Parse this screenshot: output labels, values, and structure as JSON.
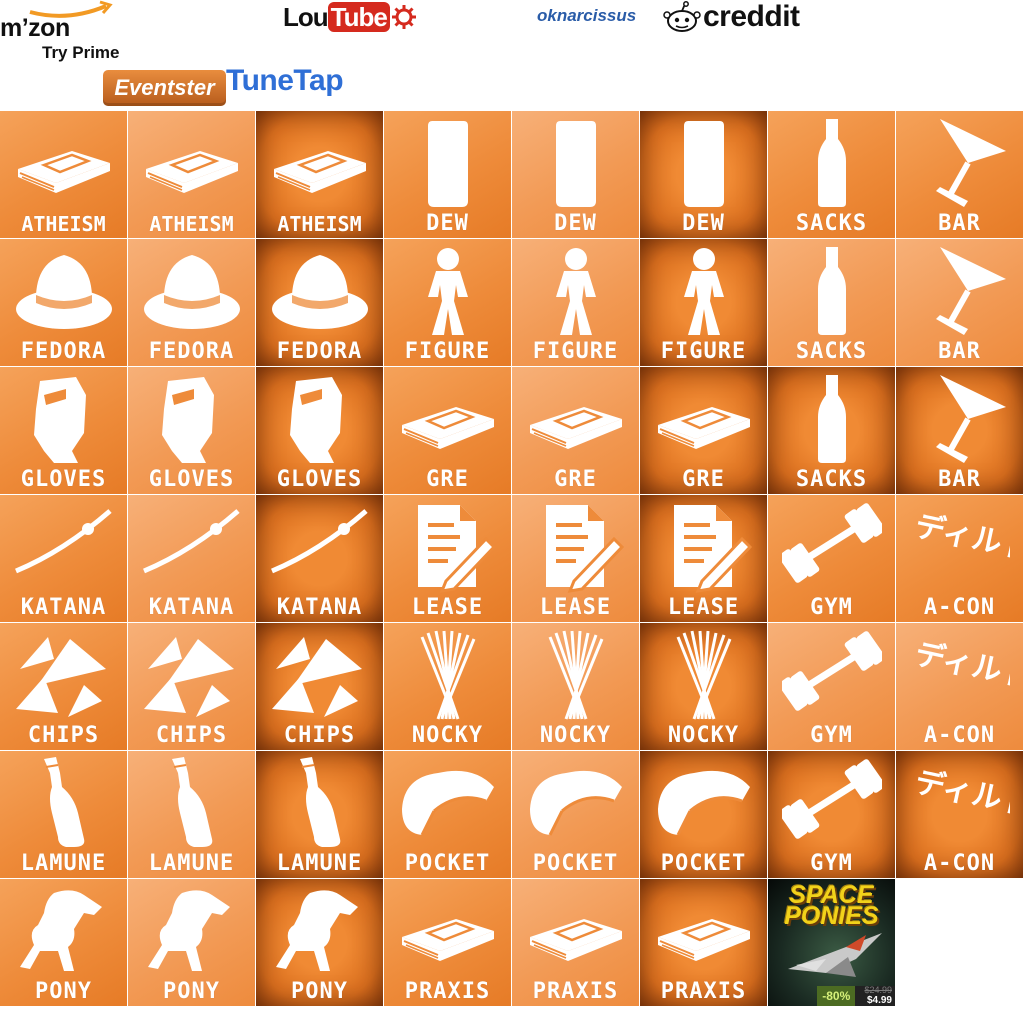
{
  "header": {
    "mzon": {
      "name": "m’zon",
      "sub": "Try Prime"
    },
    "loutube": {
      "left": "Lou",
      "right": "Tube"
    },
    "oknarcissus": "oknarcissus",
    "creddit": "creddit",
    "eventster": "Eventster",
    "tunetap": "TuneTap"
  },
  "tiles": [
    {
      "label": "ATHEISM",
      "icon": "book-icon",
      "shade": "normal"
    },
    {
      "label": "ATHEISM",
      "icon": "book-icon",
      "shade": "light"
    },
    {
      "label": "ATHEISM",
      "icon": "book-icon",
      "shade": "dark"
    },
    {
      "label": "DEW",
      "icon": "can-icon",
      "shade": "normal"
    },
    {
      "label": "DEW",
      "icon": "can-icon",
      "shade": "light"
    },
    {
      "label": "DEW",
      "icon": "can-icon",
      "shade": "dark"
    },
    {
      "label": "SACKS",
      "icon": "bottle-icon",
      "shade": "normal"
    },
    {
      "label": "BAR",
      "icon": "cocktail-icon",
      "shade": "normal"
    },
    {
      "label": "FEDORA",
      "icon": "fedora-icon",
      "shade": "normal"
    },
    {
      "label": "FEDORA",
      "icon": "fedora-icon",
      "shade": "light"
    },
    {
      "label": "FEDORA",
      "icon": "fedora-icon",
      "shade": "dark"
    },
    {
      "label": "FIGURE",
      "icon": "figure-icon",
      "shade": "normal"
    },
    {
      "label": "FIGURE",
      "icon": "figure-icon",
      "shade": "light"
    },
    {
      "label": "FIGURE",
      "icon": "figure-icon",
      "shade": "dark"
    },
    {
      "label": "SACKS",
      "icon": "bottle-icon",
      "shade": "light"
    },
    {
      "label": "BAR",
      "icon": "cocktail-icon",
      "shade": "light"
    },
    {
      "label": "GLOVES",
      "icon": "gloves-icon",
      "shade": "normal"
    },
    {
      "label": "GLOVES",
      "icon": "gloves-icon",
      "shade": "light"
    },
    {
      "label": "GLOVES",
      "icon": "gloves-icon",
      "shade": "dark"
    },
    {
      "label": "GRE",
      "icon": "book-icon",
      "shade": "normal"
    },
    {
      "label": "GRE",
      "icon": "book-icon",
      "shade": "light"
    },
    {
      "label": "GRE",
      "icon": "book-icon",
      "shade": "dark"
    },
    {
      "label": "SACKS",
      "icon": "bottle-icon",
      "shade": "dark"
    },
    {
      "label": "BAR",
      "icon": "cocktail-icon",
      "shade": "dark"
    },
    {
      "label": "KATANA",
      "icon": "katana-icon",
      "shade": "normal"
    },
    {
      "label": "KATANA",
      "icon": "katana-icon",
      "shade": "light"
    },
    {
      "label": "KATANA",
      "icon": "katana-icon",
      "shade": "dark"
    },
    {
      "label": "LEASE",
      "icon": "contract-icon",
      "shade": "normal"
    },
    {
      "label": "LEASE",
      "icon": "contract-icon",
      "shade": "light"
    },
    {
      "label": "LEASE",
      "icon": "contract-icon",
      "shade": "dark"
    },
    {
      "label": "GYM",
      "icon": "dumbbell-icon",
      "shade": "normal"
    },
    {
      "label": "A-CON",
      "icon": "japanese-text-icon",
      "shade": "normal",
      "jp": "ディルド!"
    },
    {
      "label": "CHIPS",
      "icon": "chips-icon",
      "shade": "normal"
    },
    {
      "label": "CHIPS",
      "icon": "chips-icon",
      "shade": "light"
    },
    {
      "label": "CHIPS",
      "icon": "chips-icon",
      "shade": "dark"
    },
    {
      "label": "NOCKY",
      "icon": "sticks-icon",
      "shade": "normal"
    },
    {
      "label": "NOCKY",
      "icon": "sticks-icon",
      "shade": "light"
    },
    {
      "label": "NOCKY",
      "icon": "sticks-icon",
      "shade": "dark"
    },
    {
      "label": "GYM",
      "icon": "dumbbell-icon",
      "shade": "light"
    },
    {
      "label": "A-CON",
      "icon": "japanese-text-icon",
      "shade": "light",
      "jp": "ディルド!"
    },
    {
      "label": "LAMUNE",
      "icon": "lamune-icon",
      "shade": "normal"
    },
    {
      "label": "LAMUNE",
      "icon": "lamune-icon",
      "shade": "light"
    },
    {
      "label": "LAMUNE",
      "icon": "lamune-icon",
      "shade": "dark"
    },
    {
      "label": "POCKET",
      "icon": "pocket-icon",
      "shade": "normal"
    },
    {
      "label": "POCKET",
      "icon": "pocket-icon",
      "shade": "light"
    },
    {
      "label": "POCKET",
      "icon": "pocket-icon",
      "shade": "dark"
    },
    {
      "label": "GYM",
      "icon": "dumbbell-icon",
      "shade": "dark"
    },
    {
      "label": "A-CON",
      "icon": "japanese-text-icon",
      "shade": "dark",
      "jp": "ディルド!"
    },
    {
      "label": "PONY",
      "icon": "horse-icon",
      "shade": "normal"
    },
    {
      "label": "PONY",
      "icon": "horse-icon",
      "shade": "light"
    },
    {
      "label": "PONY",
      "icon": "horse-icon",
      "shade": "dark"
    },
    {
      "label": "PRAXIS",
      "icon": "book-icon",
      "shade": "normal"
    },
    {
      "label": "PRAXIS",
      "icon": "book-icon",
      "shade": "light"
    },
    {
      "label": "PRAXIS",
      "icon": "book-icon",
      "shade": "dark"
    }
  ],
  "game": {
    "title_line1": "SPACE",
    "title_line2": "PONIES",
    "discount": "-80%",
    "old_price": "$24.99",
    "new_price": "$4.99"
  }
}
